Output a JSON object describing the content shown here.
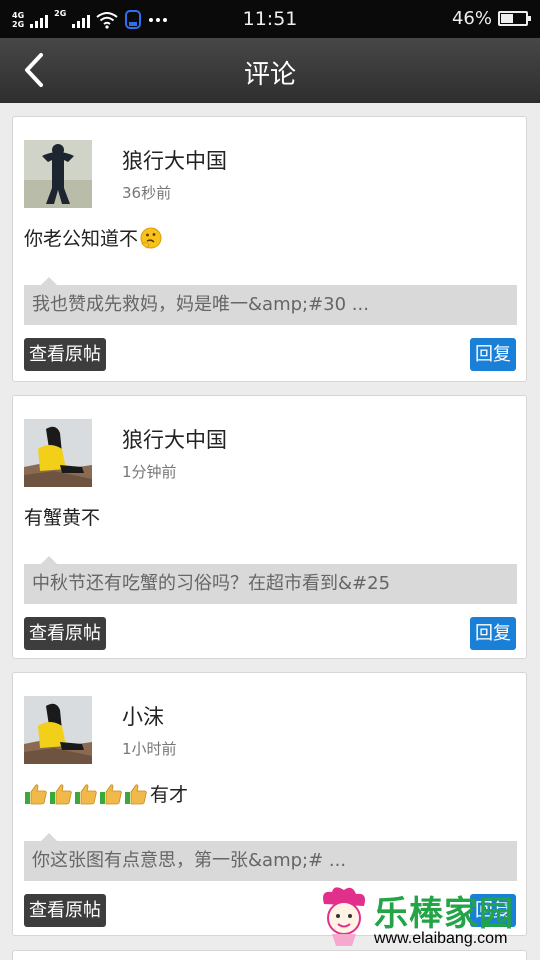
{
  "status_bar": {
    "network_top": "4G",
    "network_bottom": "2G",
    "network2": "2G",
    "time": "11:51",
    "battery_percent": "46%",
    "battery_level": 0.46
  },
  "header": {
    "title": "评论"
  },
  "comments": [
    {
      "username": "狼行大中国",
      "time": "36秒前",
      "text": "你老公知道不",
      "quote": "我也赞成先救妈，妈是唯一&amp;#30 ...",
      "view_label": "查看原帖",
      "reply_label": "回复"
    },
    {
      "username": "狼行大中国",
      "time": "1分钟前",
      "text": "有蟹黄不",
      "quote": "中秋节还有吃蟹的习俗吗？在超市看到&#25",
      "view_label": "查看原帖",
      "reply_label": "回复"
    },
    {
      "username": "小沫",
      "time": "1小时前",
      "text": "有才",
      "quote": "你这张图有点意思，第一张&amp;# ...",
      "view_label": "查看原帖",
      "reply_label": "回复"
    }
  ],
  "watermark": {
    "name": "乐棒家园",
    "url": "www.elaibang.com"
  },
  "colors": {
    "accent": "#1a7fd6",
    "dark_button": "#3d3d3d",
    "quote_bg": "#d9d9d9",
    "watermark": "#22a447"
  }
}
